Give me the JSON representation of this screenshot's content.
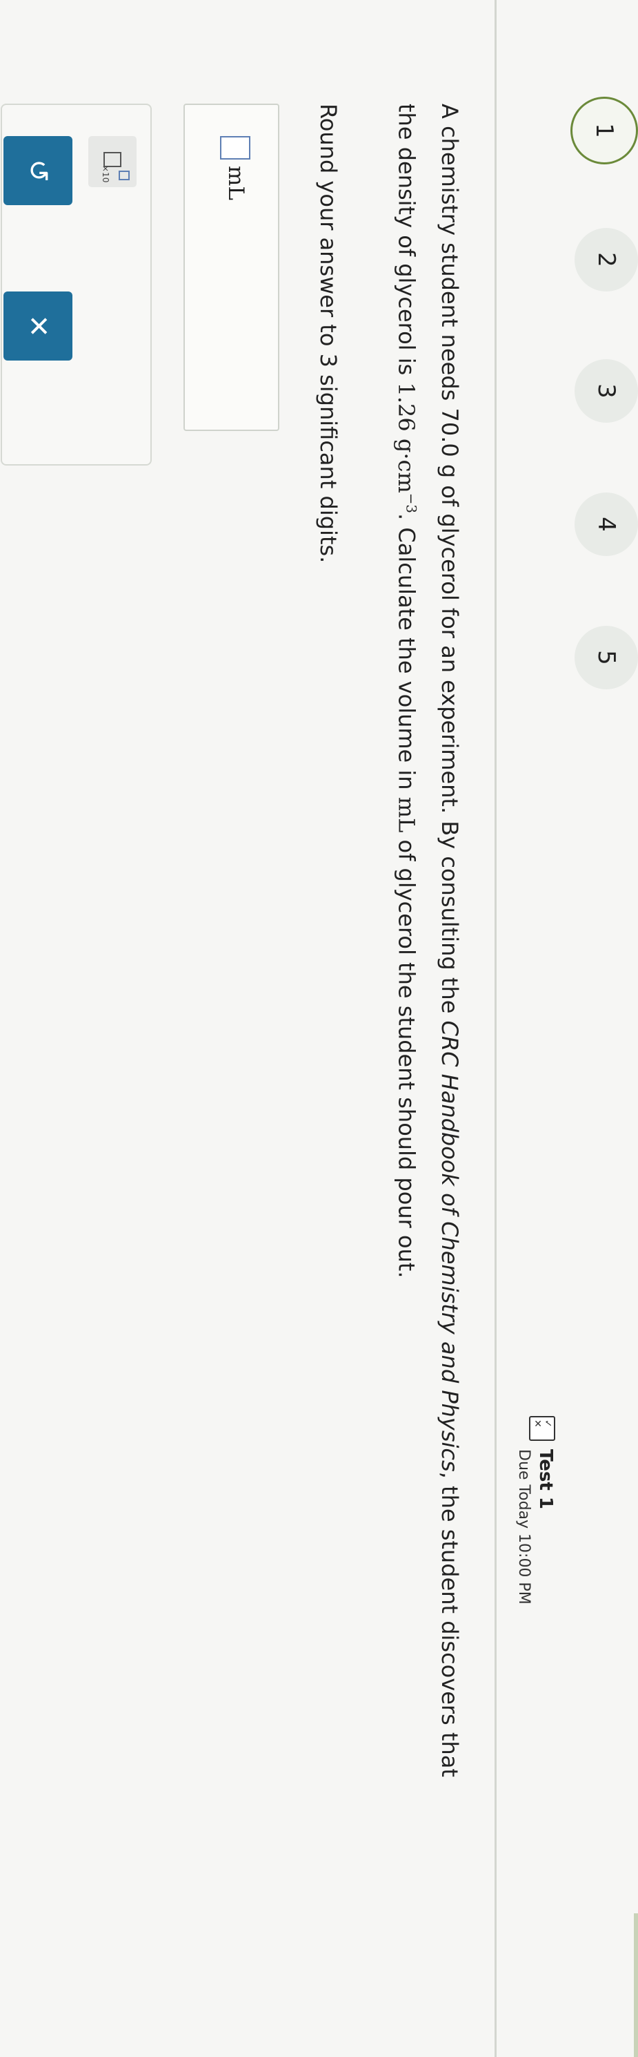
{
  "nav": {
    "questions": [
      "1",
      "2",
      "3",
      "4",
      "5"
    ],
    "active_index": 0
  },
  "test": {
    "icon_check": "✓",
    "icon_cross": "✕",
    "title": "Test 1",
    "due": "Due Today 10:00 PM"
  },
  "question": {
    "p1_before_em": "A chemistry student needs 70.0 g of glycerol for an experiment. By consulting the ",
    "book_title": "CRC Handbook of Chemistry and Physics",
    "p1_after_em": ", the student discovers that",
    "p2_before_formula": "the density of glycerol is ",
    "density_value": "1.26 g·cm",
    "density_exp": "−3",
    "p2_after_formula": ". Calculate the volume in ",
    "volume_unit": "mL",
    "p2_end": " of glycerol the student should pour out.",
    "round_text": "Round your answer to 3 significant digits."
  },
  "answer": {
    "unit": "mL"
  },
  "tools": {
    "sci_label": "×10",
    "reset_icon": "↺",
    "clear_icon": "✕"
  },
  "colors": {
    "accent_green": "#6b8a3a",
    "action_blue": "#1f6f9b",
    "placeholder_blue": "#5e7fb4"
  }
}
